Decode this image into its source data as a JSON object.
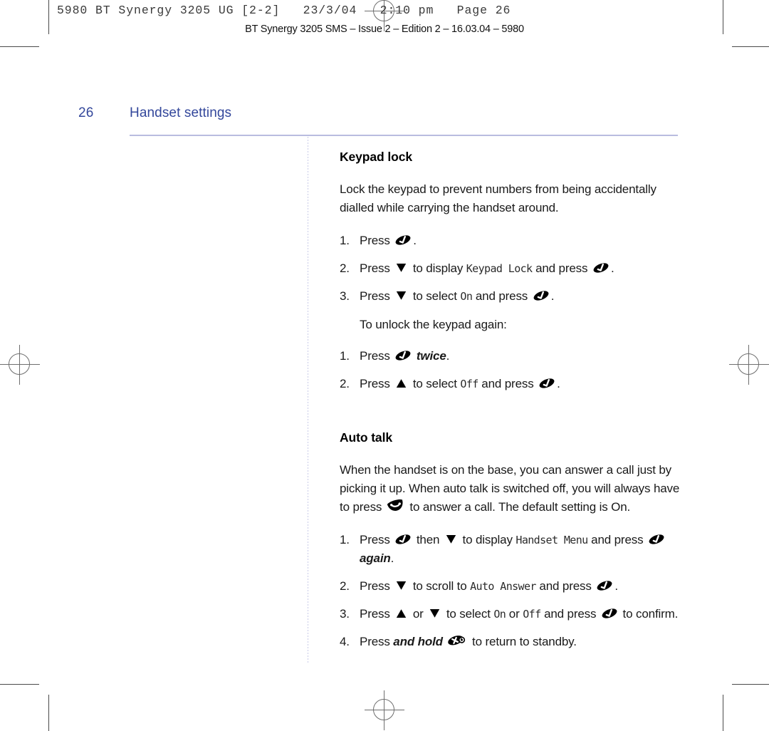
{
  "prepress": {
    "slug": "5980 BT Synergy 3205 UG [2-2]   23/3/04   2:10 pm   Page 26",
    "footer_slug": "BT Synergy 3205 SMS – Issue 2 – Edition 2 – 16.03.04 – 5980"
  },
  "header": {
    "page_number": "26",
    "title": "Handset settings",
    "rule_color": "#b9bce0",
    "text_color": "#33479b"
  },
  "sections": [
    {
      "heading": "Keypad lock",
      "intro": "Lock the keypad to prevent numbers from being accidentally dialled while carrying the handset around.",
      "steps_1": [
        {
          "num": "1.",
          "parts": [
            {
              "t": "text",
              "v": "Press "
            },
            {
              "t": "icon",
              "v": "menu-select-key"
            },
            {
              "t": "text",
              "v": "."
            }
          ]
        },
        {
          "num": "2.",
          "parts": [
            {
              "t": "text",
              "v": "Press "
            },
            {
              "t": "icon",
              "v": "down-arrow-key"
            },
            {
              "t": "text",
              "v": " to display "
            },
            {
              "t": "lcd",
              "v": "Keypad Lock"
            },
            {
              "t": "text",
              "v": " and press "
            },
            {
              "t": "icon",
              "v": "menu-select-key"
            },
            {
              "t": "text",
              "v": "."
            }
          ]
        },
        {
          "num": "3.",
          "parts": [
            {
              "t": "text",
              "v": "Press "
            },
            {
              "t": "icon",
              "v": "down-arrow-key"
            },
            {
              "t": "text",
              "v": " to select "
            },
            {
              "t": "lcd",
              "v": "On"
            },
            {
              "t": "text",
              "v": " and press "
            },
            {
              "t": "icon",
              "v": "menu-select-key"
            },
            {
              "t": "text",
              "v": "."
            }
          ]
        }
      ],
      "unlock_note": "To unlock the keypad again:",
      "steps_2": [
        {
          "num": "1.",
          "parts": [
            {
              "t": "text",
              "v": "Press "
            },
            {
              "t": "icon",
              "v": "menu-select-key"
            },
            {
              "t": "bolditalic",
              "v": " twice"
            },
            {
              "t": "text",
              "v": "."
            }
          ]
        },
        {
          "num": "2.",
          "parts": [
            {
              "t": "text",
              "v": "Press "
            },
            {
              "t": "icon",
              "v": "up-arrow-key"
            },
            {
              "t": "text",
              "v": " to select "
            },
            {
              "t": "lcd",
              "v": "Off"
            },
            {
              "t": "text",
              "v": " and press "
            },
            {
              "t": "icon",
              "v": "menu-select-key"
            },
            {
              "t": "text",
              "v": "."
            }
          ]
        }
      ]
    },
    {
      "heading": "Auto talk",
      "intro_parts": [
        {
          "t": "text",
          "v": "When the handset is on the base, you can answer a call just by picking it up. When auto talk is switched off, you will always have to press "
        },
        {
          "t": "icon",
          "v": "talk-key"
        },
        {
          "t": "text",
          "v": " to answer a call. The default setting is On."
        }
      ],
      "steps_1": [
        {
          "num": "1.",
          "parts": [
            {
              "t": "text",
              "v": "Press "
            },
            {
              "t": "icon",
              "v": "menu-select-key"
            },
            {
              "t": "text",
              "v": " then "
            },
            {
              "t": "icon",
              "v": "down-arrow-key"
            },
            {
              "t": "text",
              "v": " to display "
            },
            {
              "t": "lcd",
              "v": "Handset Menu"
            },
            {
              "t": "text",
              "v": " and press "
            },
            {
              "t": "icon",
              "v": "menu-select-key"
            },
            {
              "t": "bolditalic",
              "v": " again"
            },
            {
              "t": "text",
              "v": "."
            }
          ]
        },
        {
          "num": "2.",
          "parts": [
            {
              "t": "text",
              "v": "Press "
            },
            {
              "t": "icon",
              "v": "down-arrow-key"
            },
            {
              "t": "text",
              "v": " to scroll to "
            },
            {
              "t": "lcd",
              "v": "Auto Answer"
            },
            {
              "t": "text",
              "v": " and press "
            },
            {
              "t": "icon",
              "v": "menu-select-key"
            },
            {
              "t": "text",
              "v": "."
            }
          ]
        },
        {
          "num": "3.",
          "parts": [
            {
              "t": "text",
              "v": "Press "
            },
            {
              "t": "icon",
              "v": "up-arrow-key"
            },
            {
              "t": "text",
              "v": " or "
            },
            {
              "t": "icon",
              "v": "down-arrow-key"
            },
            {
              "t": "text",
              "v": " to select "
            },
            {
              "t": "lcd",
              "v": "On"
            },
            {
              "t": "text",
              "v": " or "
            },
            {
              "t": "lcd",
              "v": "Off"
            },
            {
              "t": "text",
              "v": " and press "
            },
            {
              "t": "icon",
              "v": "menu-select-key"
            },
            {
              "t": "text",
              "v": " to confirm."
            }
          ]
        },
        {
          "num": "4.",
          "parts": [
            {
              "t": "text",
              "v": "Press "
            },
            {
              "t": "bolditalic",
              "v": "and hold"
            },
            {
              "t": "text",
              "v": " "
            },
            {
              "t": "icon",
              "v": "end-call-key"
            },
            {
              "t": "text",
              "v": " to return to standby."
            }
          ]
        }
      ]
    }
  ]
}
